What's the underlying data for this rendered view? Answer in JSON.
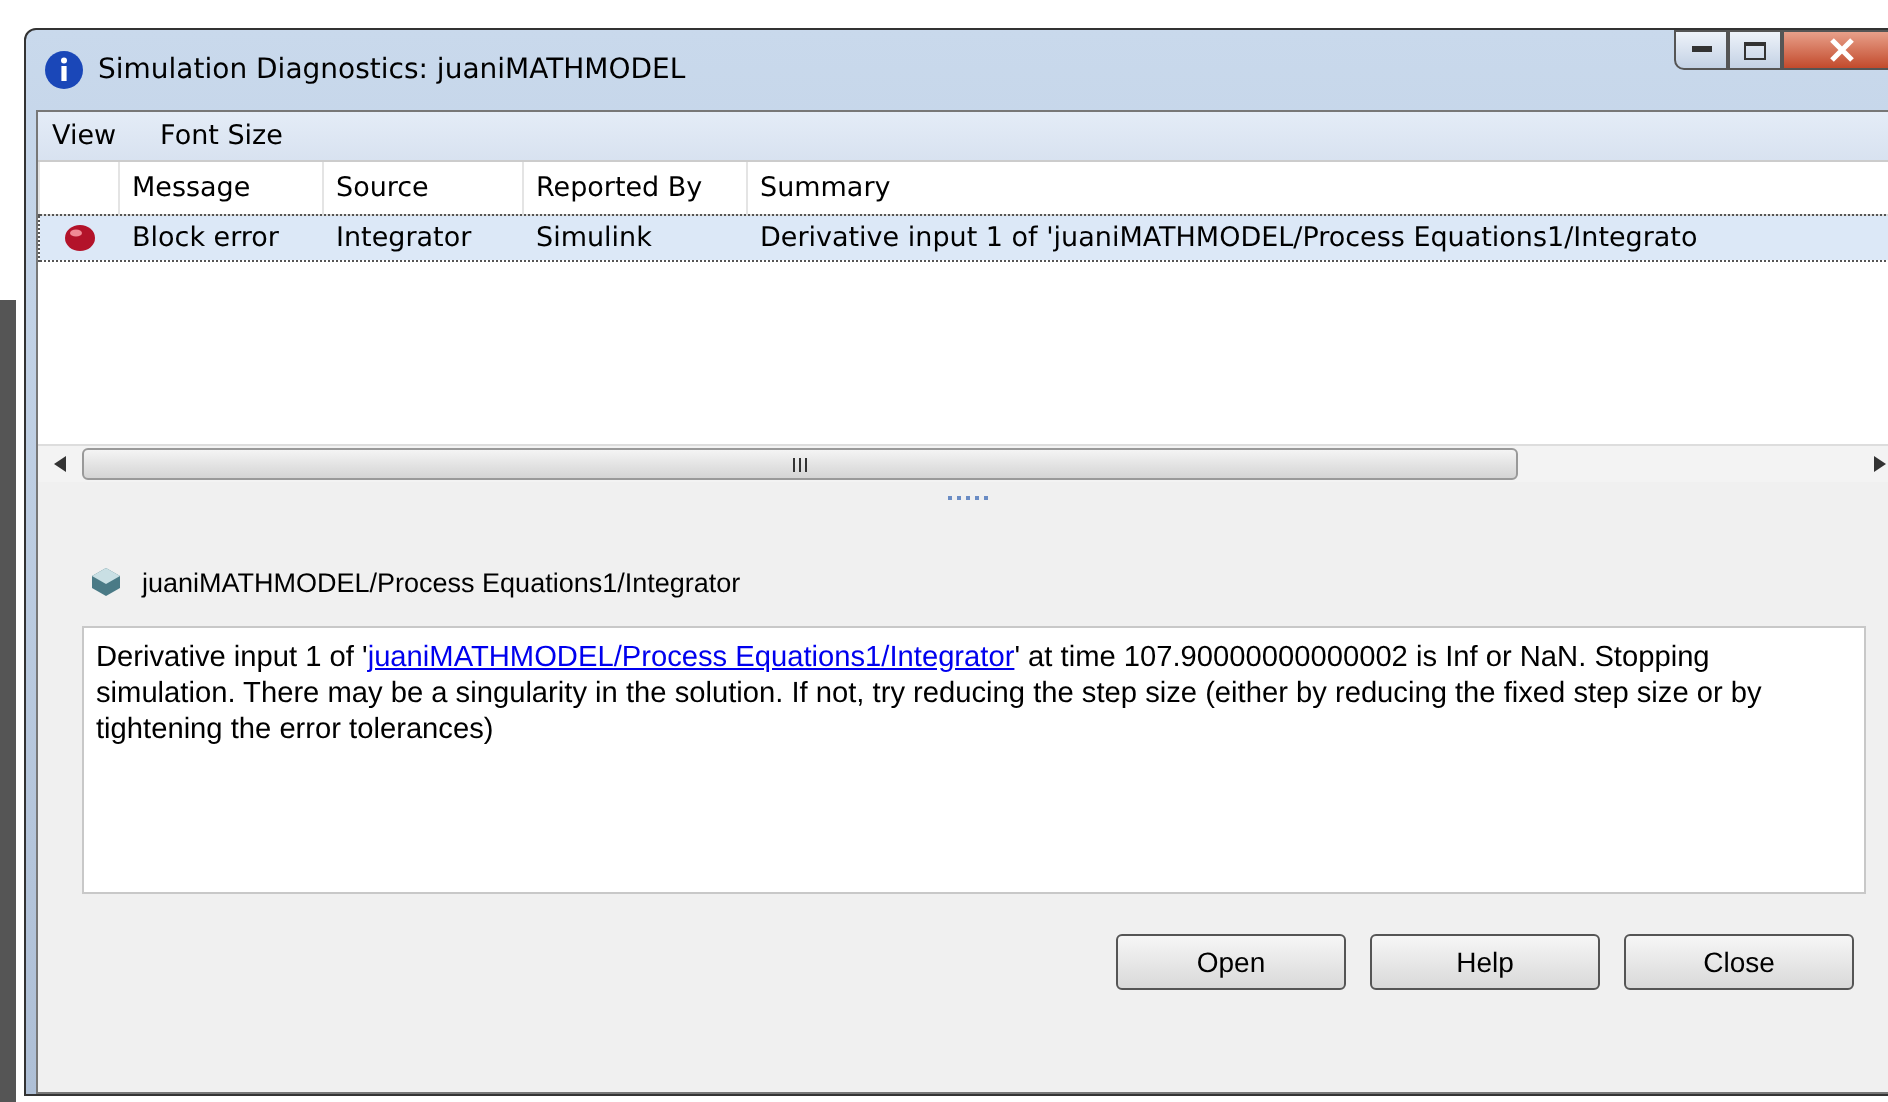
{
  "window": {
    "title": "Simulation Diagnostics: juaniMATHMODEL"
  },
  "menu": [
    "View",
    "Font Size"
  ],
  "table": {
    "columns": [
      "Message",
      "Source",
      "Reported By",
      "Summary"
    ],
    "rows": [
      {
        "selected": true,
        "kind": "error",
        "cells": [
          "Block error",
          "Integrator",
          "Simulink",
          "Derivative input 1 of 'juaniMATHMODEL/Process Equations1/Integrato"
        ]
      }
    ]
  },
  "detail": {
    "path": "juaniMATHMODEL/Process Equations1/Integrator",
    "message_before": "Derivative input 1 of '",
    "message_link": "juaniMATHMODEL/Process Equations1/Integrator",
    "message_after": "' at time 107.90000000000002 is Inf or NaN. Stopping simulation. There may be a singularity in the solution. If not, try reducing the step size (either by reducing the fixed step size or by tightening the error tolerances)"
  },
  "buttons": [
    "Open",
    "Help",
    "Close"
  ]
}
